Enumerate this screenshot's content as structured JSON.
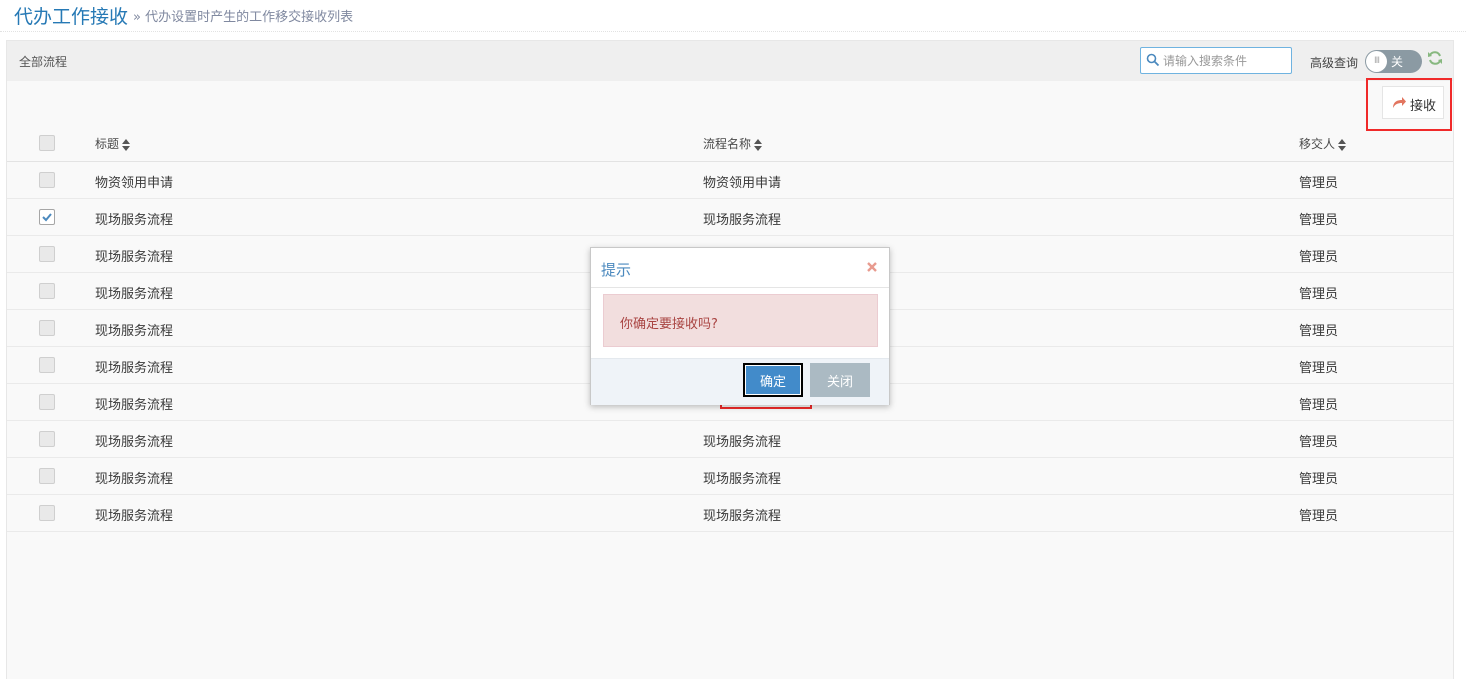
{
  "page": {
    "title": "代办工作接收",
    "subtitle": "» 代办设置时产生的工作移交接收列表"
  },
  "toolbar": {
    "all_flows": "全部流程",
    "search_placeholder": "请输入搜索条件",
    "advanced_label": "高级查询",
    "toggle_knob": "III",
    "toggle_text": "关",
    "accept_label": "接收"
  },
  "table": {
    "headers": {
      "title": "标题",
      "flow": "流程名称",
      "user": "移交人"
    },
    "rows": [
      {
        "title": "物资领用申请",
        "flow": "物资领用申请",
        "user": "管理员",
        "checked": false
      },
      {
        "title": "现场服务流程",
        "flow": "现场服务流程",
        "user": "管理员",
        "checked": true
      },
      {
        "title": "现场服务流程",
        "flow": "",
        "user": "管理员",
        "checked": false
      },
      {
        "title": "现场服务流程",
        "flow": "",
        "user": "管理员",
        "checked": false
      },
      {
        "title": "现场服务流程",
        "flow": "",
        "user": "管理员",
        "checked": false
      },
      {
        "title": "现场服务流程",
        "flow": "",
        "user": "管理员",
        "checked": false
      },
      {
        "title": "现场服务流程",
        "flow": "",
        "user": "管理员",
        "checked": false
      },
      {
        "title": "现场服务流程",
        "flow": "现场服务流程",
        "user": "管理员",
        "checked": false
      },
      {
        "title": "现场服务流程",
        "flow": "现场服务流程",
        "user": "管理员",
        "checked": false
      },
      {
        "title": "现场服务流程",
        "flow": "现场服务流程",
        "user": "管理员",
        "checked": false
      }
    ]
  },
  "dialog": {
    "title": "提示",
    "message": "你确定要接收吗?",
    "ok_label": "确定",
    "close_label": "关闭"
  },
  "colors": {
    "accent": "#428bca",
    "highlight": "#f02a2a",
    "alert_bg": "#f2dede"
  }
}
